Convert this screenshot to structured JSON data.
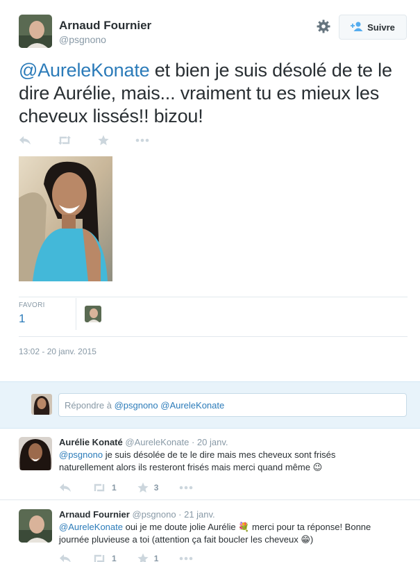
{
  "tweet": {
    "author_name": "Arnaud Fournier",
    "author_handle": "@psgnono",
    "follow_label": "Suivre",
    "mention": "@AureleKonate",
    "text": " et bien je suis désolé de te le dire Aurélie, mais... vraiment tu es mieux les cheveux lissés!! bizou!",
    "favorites_label": "FAVORI",
    "favorites_count": "1",
    "timestamp": "13:02 - 20 janv. 2015"
  },
  "reply_box": {
    "prefix": "Répondre à ",
    "mentions": "@psgnono @AureleKonate"
  },
  "replies": [
    {
      "name": "Aurélie Konaté",
      "handle": "@AureleKonate",
      "date": " · 20 janv.",
      "mention": "@psgnono",
      "text": " je suis désolée de te le dire mais mes cheveux sont frisés naturellement alors ils resteront frisés mais merci quand même 😉",
      "retweets": "1",
      "favorites": "3"
    },
    {
      "name": "Arnaud Fournier",
      "handle": "@psgnono",
      "date": " · 21 janv.",
      "mention": "@AureleKonate",
      "text": " oui je me doute jolie Aurélie 💐 merci pour ta réponse! Bonne journée pluvieuse a toi (attention ça fait boucler les cheveux 😁)",
      "retweets": "1",
      "favorites": "1"
    }
  ],
  "colors": {
    "link": "#2b7bb9",
    "muted": "#8899a6",
    "icon": "#ccd6dd",
    "reply_band": "#e8f3fa"
  },
  "icons": [
    "gear-icon",
    "follow-person-icon",
    "reply-icon",
    "retweet-icon",
    "favorite-star-icon",
    "more-dots-icon"
  ]
}
